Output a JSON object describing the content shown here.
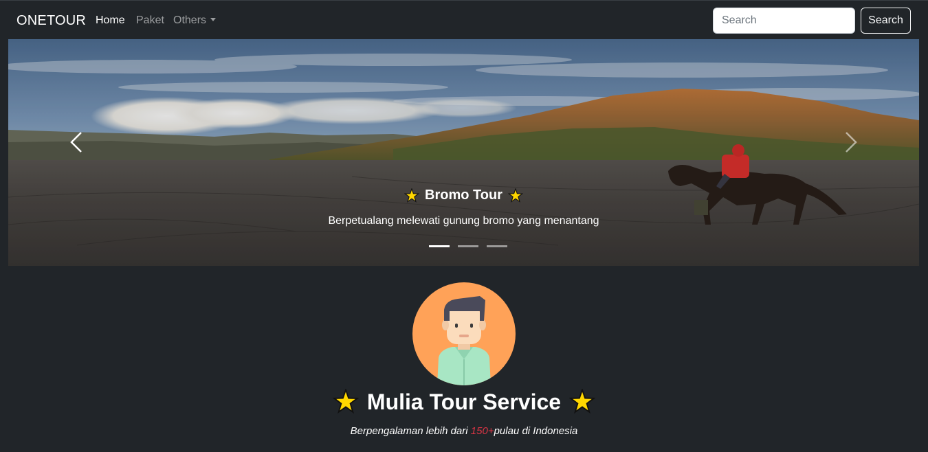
{
  "navbar": {
    "brand": "ONETOUR",
    "items": [
      {
        "label": "Home",
        "active": true
      },
      {
        "label": "Paket",
        "active": false
      },
      {
        "label": "Others",
        "active": false,
        "dropdown": true
      }
    ],
    "search": {
      "placeholder": "Search",
      "value": "",
      "button_label": "Search"
    }
  },
  "carousel": {
    "slides_count": 3,
    "active_slide": 1,
    "caption": {
      "title": "Bromo Tour",
      "text": "Berpetualang melewati gunung bromo yang menantang"
    }
  },
  "profile": {
    "name": "Mulia Tour Service",
    "tagline_prefix": "Berpengalaman lebih dari ",
    "tagline_highlight": "150+",
    "tagline_suffix": "pulau di Indonesia"
  },
  "colors": {
    "background": "#212529",
    "highlight": "#dc3545",
    "star": "#ffd700",
    "avatar_bg": "#ffa258"
  },
  "icons": [
    "star-icon",
    "chevron-left-icon",
    "chevron-right-icon",
    "avatar-person"
  ]
}
